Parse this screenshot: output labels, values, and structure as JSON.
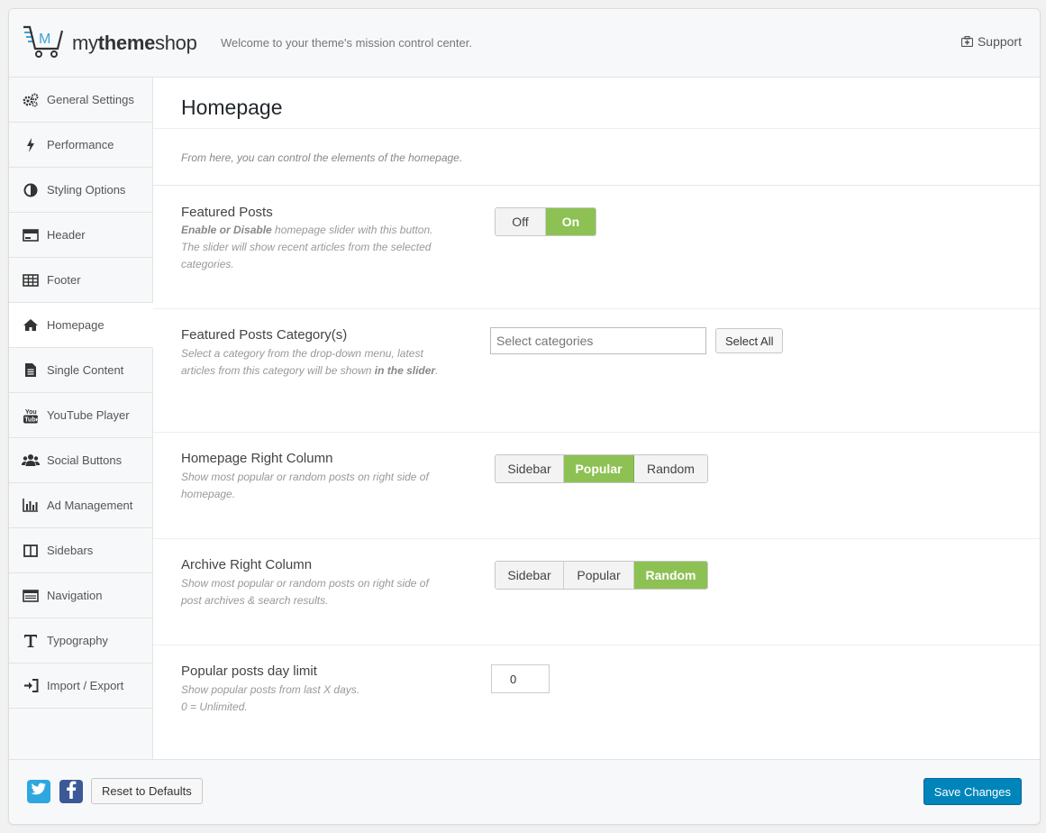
{
  "header": {
    "brand_prefix": "my",
    "brand_bold": "theme",
    "brand_suffix": "shop",
    "welcome": "Welcome to your theme's mission control center.",
    "support_label": "Support"
  },
  "sidebar": {
    "items": [
      {
        "label": "General Settings",
        "icon": "gears-icon"
      },
      {
        "label": "Performance",
        "icon": "bolt-icon"
      },
      {
        "label": "Styling Options",
        "icon": "contrast-icon"
      },
      {
        "label": "Header",
        "icon": "header-icon"
      },
      {
        "label": "Footer",
        "icon": "table-icon"
      },
      {
        "label": "Homepage",
        "icon": "home-icon",
        "active": true
      },
      {
        "label": "Single Content",
        "icon": "document-icon"
      },
      {
        "label": "YouTube Player",
        "icon": "youtube-icon"
      },
      {
        "label": "Social Buttons",
        "icon": "users-icon"
      },
      {
        "label": "Ad Management",
        "icon": "bar-chart-icon"
      },
      {
        "label": "Sidebars",
        "icon": "columns-icon"
      },
      {
        "label": "Navigation",
        "icon": "list-icon"
      },
      {
        "label": "Typography",
        "icon": "text-icon"
      },
      {
        "label": "Import / Export",
        "icon": "sign-in-icon"
      }
    ]
  },
  "main": {
    "title": "Homepage",
    "intro": "From here, you can control the elements of the homepage.",
    "featured": {
      "label": "Featured Posts",
      "desc_bold": "Enable or Disable",
      "desc_rest": " homepage slider with this button. The slider will show recent articles from the selected categories.",
      "off": "Off",
      "on": "On"
    },
    "category": {
      "label": "Featured Posts Category(s)",
      "desc_a": "Select a category from the drop-down menu, latest articles from this category will be shown ",
      "desc_bold": "in the slider",
      "desc_end": ".",
      "placeholder": "Select categories",
      "select_all": "Select All"
    },
    "home_right": {
      "label": "Homepage Right Column",
      "desc": "Show most popular or random posts on right side of homepage.",
      "options": [
        "Sidebar",
        "Popular",
        "Random"
      ],
      "selected": "Popular"
    },
    "archive_right": {
      "label": "Archive Right Column",
      "desc": "Show most popular or random posts on right side of post archives & search results.",
      "options": [
        "Sidebar",
        "Popular",
        "Random"
      ],
      "selected": "Random"
    },
    "day_limit": {
      "label": "Popular posts day limit",
      "desc1": "Show popular posts from last X days.",
      "desc2": "0 = Unlimited.",
      "value": "0"
    }
  },
  "footer": {
    "reset_label": "Reset to Defaults",
    "save_label": "Save Changes"
  },
  "colors": {
    "toggle_on": "#8dc153",
    "save_button": "#0085ba",
    "twitter": "#2ea7e0",
    "facebook": "#3b5998"
  }
}
